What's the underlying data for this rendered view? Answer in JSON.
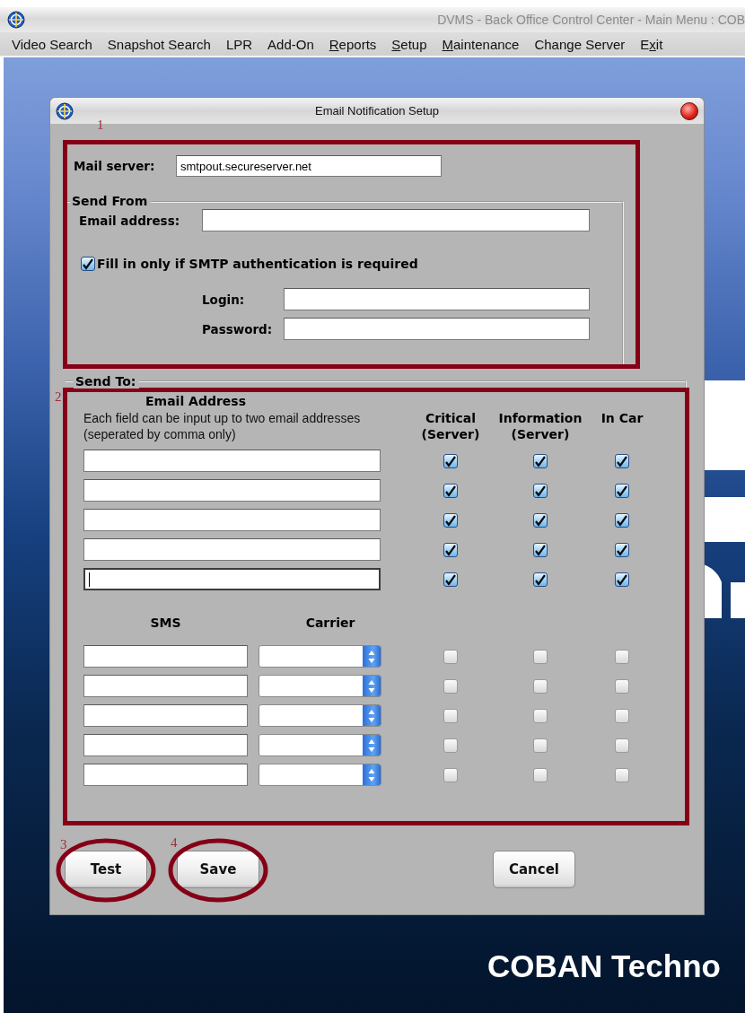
{
  "window": {
    "title": "DVMS - Back Office Control Center - Main Menu : COB"
  },
  "menu": [
    {
      "label_parts": [
        "Video Search"
      ]
    },
    {
      "label_parts": [
        "Snapshot Search"
      ]
    },
    {
      "label_parts": [
        "LPR"
      ]
    },
    {
      "label_parts": [
        "Add-On"
      ]
    },
    {
      "label_parts": [
        "R",
        "eports"
      ],
      "key_first": true
    },
    {
      "label_parts": [
        "S",
        "etup"
      ],
      "key_first": true
    },
    {
      "label_parts": [
        "M",
        "aintenance"
      ],
      "key_first": true
    },
    {
      "label_parts": [
        "Change Server"
      ]
    },
    {
      "label_parts": [
        "E",
        "x",
        "it"
      ]
    }
  ],
  "dialog": {
    "title": "Email Notification Setup",
    "mail_server": {
      "label": "Mail server:",
      "value": "smtpout.secureserver.net"
    },
    "send_from": {
      "legend": "Send From",
      "email_label": "Email address:",
      "auth_checkbox": {
        "label": "Fill in only if SMTP authentication is required",
        "checked": true
      },
      "login_label": "Login:",
      "password_label": "Password:"
    },
    "send_to": {
      "legend": "Send To:",
      "email_header": "Email Address",
      "email_hint": "Each field can be input up to two email addresses\n(seperated by comma only)",
      "columns": [
        "Critical\n(Server)",
        "Information\n(Server)",
        "In Car"
      ],
      "email_rows": [
        {
          "focused": false,
          "critical": true,
          "information": true,
          "in_car": true
        },
        {
          "focused": false,
          "critical": true,
          "information": true,
          "in_car": true
        },
        {
          "focused": false,
          "critical": true,
          "information": true,
          "in_car": true
        },
        {
          "focused": false,
          "critical": true,
          "information": true,
          "in_car": true
        },
        {
          "focused": true,
          "critical": true,
          "information": true,
          "in_car": true
        }
      ],
      "sms_header": "SMS",
      "carrier_header": "Carrier",
      "sms_rows": [
        {
          "critical": false,
          "information": false,
          "in_car": false
        },
        {
          "critical": false,
          "information": false,
          "in_car": false
        },
        {
          "critical": false,
          "information": false,
          "in_car": false
        },
        {
          "critical": false,
          "information": false,
          "in_car": false
        },
        {
          "critical": false,
          "information": false,
          "in_car": false
        }
      ]
    },
    "buttons": [
      {
        "label": "Test"
      },
      {
        "label": "Save"
      },
      {
        "label": "Cancel"
      }
    ]
  },
  "annotations": [
    "1",
    "2",
    "3",
    "4"
  ],
  "wallpaper_text": "COBAN Techno"
}
